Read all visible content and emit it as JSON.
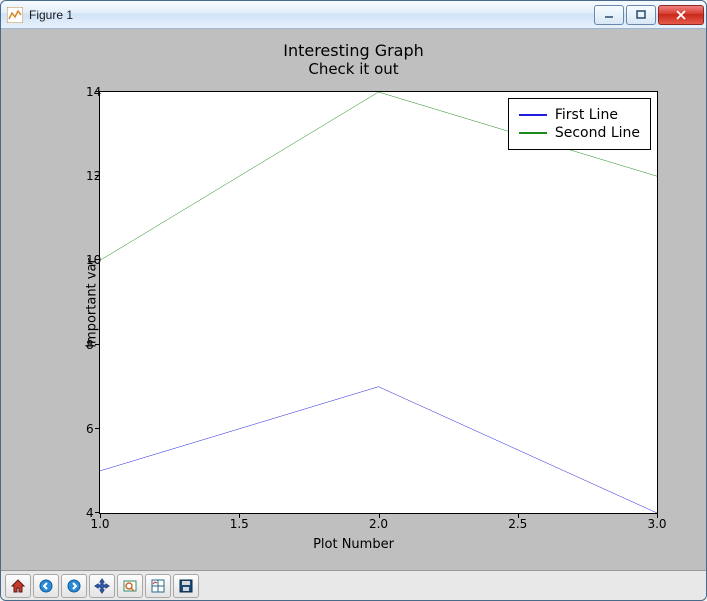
{
  "window": {
    "title": "Figure 1"
  },
  "chart_data": {
    "type": "line",
    "title": "Interesting Graph",
    "subtitle": "Check it out",
    "xlabel": "Plot Number",
    "ylabel": "Important var",
    "x": [
      1.0,
      2.0,
      3.0
    ],
    "xlim": [
      1.0,
      3.0
    ],
    "ylim": [
      4,
      14
    ],
    "xticks": [
      "1.0",
      "1.5",
      "2.0",
      "2.5",
      "3.0"
    ],
    "yticks": [
      "4",
      "6",
      "8",
      "10",
      "12",
      "14"
    ],
    "series": [
      {
        "name": "First Line",
        "color": "#1f1fdf",
        "values": [
          5,
          7,
          4
        ]
      },
      {
        "name": "Second Line",
        "color": "#1a8a1a",
        "values": [
          10,
          14,
          12
        ]
      }
    ],
    "legend_position": "upper right"
  },
  "toolbar": {
    "buttons": [
      "home",
      "back",
      "forward",
      "pan",
      "zoom",
      "subplots",
      "save"
    ]
  }
}
